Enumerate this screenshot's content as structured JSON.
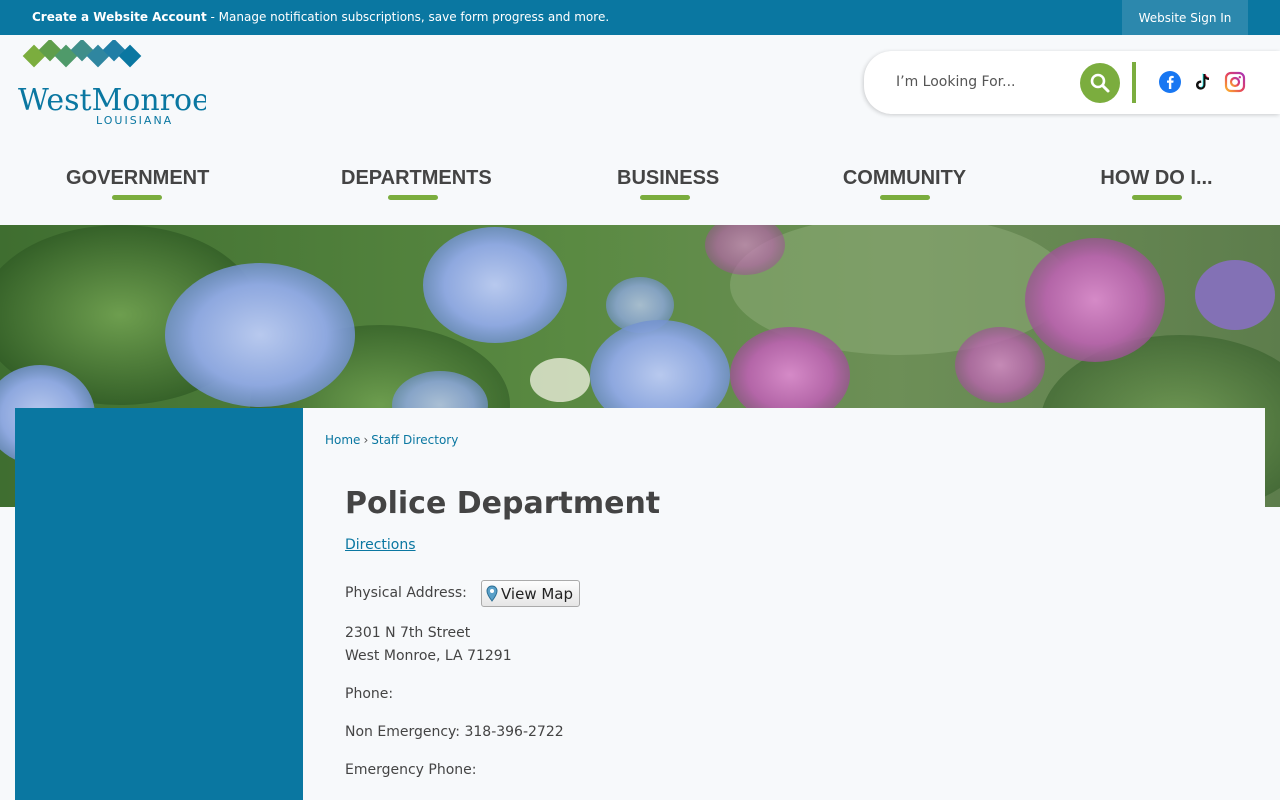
{
  "topbar": {
    "account_link": "Create a Website Account",
    "account_desc": " - Manage notification subscriptions, save form progress and more.",
    "sign_in": "Website Sign In"
  },
  "header": {
    "logo_text_main": "WestMonroe",
    "logo_text_sub": "LOUISIANA",
    "search_placeholder": "I’m Looking For...",
    "social": [
      "facebook-icon",
      "tiktok-icon",
      "instagram-icon"
    ]
  },
  "nav": {
    "items": [
      "GOVERNMENT",
      "DEPARTMENTS",
      "BUSINESS",
      "COMMUNITY",
      "HOW DO I..."
    ]
  },
  "breadcrumb": {
    "home": "Home",
    "separator": "›",
    "current": "Staff Directory"
  },
  "department": {
    "title": "Police Department",
    "directions": "Directions",
    "address_label": "Physical Address:",
    "view_map": "View Map",
    "address_line1": "2301 N 7th Street",
    "address_line2": "West Monroe, LA 71291",
    "phone_label": "Phone:",
    "non_emergency": "Non Emergency: 318-396-2722",
    "emergency_label": "Emergency Phone:"
  },
  "colors": {
    "brand_blue": "#0a77a1",
    "accent_green": "#7bad3e"
  }
}
